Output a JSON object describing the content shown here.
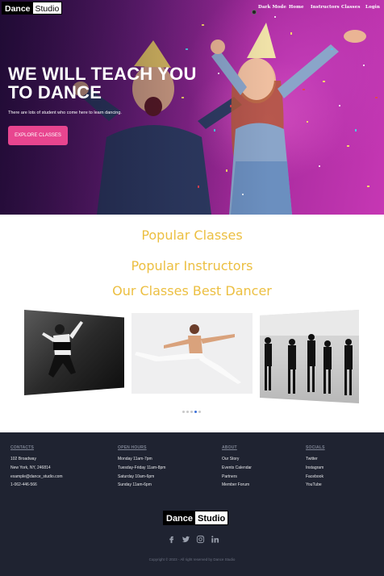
{
  "brand": {
    "part1": "Dance",
    "part2": "Studio"
  },
  "nav": {
    "items": [
      {
        "label": "Dark Mode"
      },
      {
        "label": "Home"
      },
      {
        "label": "Instructors"
      },
      {
        "label": "Classes"
      },
      {
        "label": "Login"
      }
    ]
  },
  "hero": {
    "title": "WE WILL TEACH YOU TO DANCE",
    "subtitle": "There are lots of student who come here to learn dancing.",
    "cta": "EXPLORE CLASSES",
    "accent": "#e8458f"
  },
  "sections": {
    "popular_classes": "Popular Classes",
    "popular_instructors": "Popular Instructors",
    "best_dancer": "Our Classes Best Dancer",
    "title_color": "#ecbf41"
  },
  "carousel": {
    "slides": [
      "dancer-jump-image",
      "ballet-leap-image",
      "ballet-class-image"
    ],
    "dot_count": 5,
    "active_dot": 4
  },
  "footer": {
    "contacts": {
      "heading": "CONTACTS",
      "lines": [
        "102 Broadway",
        "New York, NY, 246814",
        "example@dance_studio.com",
        "1-062-446-566"
      ]
    },
    "open_hours": {
      "heading": "OPEN HOURS",
      "lines": [
        "Monday 11am-7pm",
        "Tuesday-Friday 11am-8pm",
        "Saturday 10am-6pm",
        "Sunday 11am-6pm"
      ]
    },
    "about": {
      "heading": "ABOUT",
      "lines": [
        "Our Story",
        "Events Calendar",
        "Partners",
        "Member Forum"
      ]
    },
    "socials": {
      "heading": "SOCIALS",
      "lines": [
        "Twitter",
        "Instagram",
        "Facebook",
        "YouTube"
      ]
    },
    "social_icons": [
      "facebook-icon",
      "twitter-icon",
      "instagram-icon",
      "linkedin-icon"
    ],
    "copyright": "Copyright © 2023 - All right reserved by Dance Studio"
  }
}
